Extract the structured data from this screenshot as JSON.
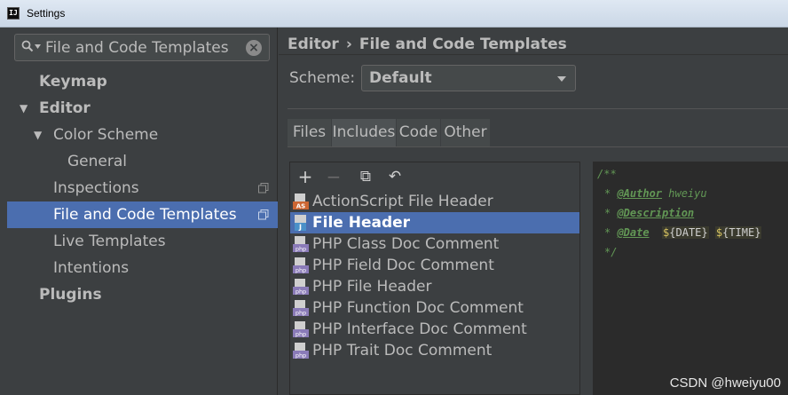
{
  "window": {
    "title": "Settings",
    "icon_text": "IJ"
  },
  "sidebar": {
    "search": {
      "value": "File and Code Templates"
    },
    "items": [
      {
        "label": "Keymap"
      },
      {
        "label": "Editor"
      },
      {
        "label": "Color Scheme"
      },
      {
        "label": "General"
      },
      {
        "label": "Inspections"
      },
      {
        "label": "File and Code Templates"
      },
      {
        "label": "Live Templates"
      },
      {
        "label": "Intentions"
      },
      {
        "label": "Plugins"
      }
    ]
  },
  "main": {
    "breadcrumb": {
      "root": "Editor",
      "separator": "›",
      "current": "File and Code Templates"
    },
    "scheme": {
      "label": "Scheme:",
      "value": "Default"
    },
    "tabs": [
      {
        "label": "Files"
      },
      {
        "label": "Includes"
      },
      {
        "label": "Code"
      },
      {
        "label": "Other"
      }
    ],
    "toolbar": {
      "add": "+",
      "remove": "−",
      "copy": "⧉",
      "reset": "↶"
    },
    "templates": [
      {
        "label": "ActionScript File Header",
        "icon_text": "AS"
      },
      {
        "label": "File Header",
        "icon_text": "J"
      },
      {
        "label": "PHP Class Doc Comment",
        "icon_text": "php"
      },
      {
        "label": "PHP Field Doc Comment",
        "icon_text": "php"
      },
      {
        "label": "PHP File Header",
        "icon_text": "php"
      },
      {
        "label": "PHP Function Doc Comment",
        "icon_text": "php"
      },
      {
        "label": "PHP Interface Doc Comment",
        "icon_text": "php"
      },
      {
        "label": "PHP Trait Doc Comment",
        "icon_text": "php"
      }
    ],
    "editor": {
      "line1": "/**",
      "line2_prefix": "* ",
      "line2_tag": "@Author",
      "line2_value": " hweiyu",
      "line3_prefix": "* ",
      "line3_tag": "@Description",
      "line4_prefix": "* ",
      "line4_tag": "@Date",
      "date_dollar": "$",
      "date_var": "{DATE}",
      "time_dollar": "$",
      "time_var": "{TIME}",
      "line5": "*/"
    }
  },
  "watermark": "CSDN @hweiyu00",
  "colors": {
    "selection": "#4b6eaf",
    "background": "#3c3f41",
    "editor_bg": "#2b2b2b",
    "doc_comment": "#629755"
  }
}
